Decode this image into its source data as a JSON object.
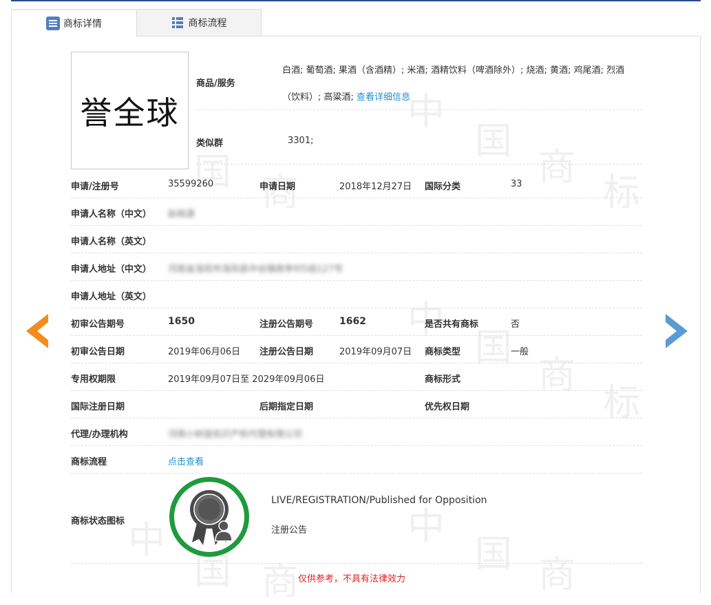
{
  "tabs": [
    {
      "label": "商标详情",
      "icon": "detail-list-icon"
    },
    {
      "label": "商标流程",
      "icon": "flow-list-icon"
    }
  ],
  "watermark_chars": [
    "中",
    "国",
    "商",
    "标"
  ],
  "logo": {
    "text": "誉全球"
  },
  "goods": {
    "label": "商品/服务",
    "line1": "白酒; 葡萄酒; 果酒（含酒精）; 米酒; 酒精饮料（啤酒除外）; 烧酒; 黄酒; 鸡尾酒; 烈酒",
    "line2": "（饮料）; 高粱酒;",
    "more_link": "查看详细信息"
  },
  "similar_group": {
    "label": "类似群",
    "value": "3301;"
  },
  "fields": {
    "reg_no": {
      "label": "申请/注册号",
      "value": "35599260"
    },
    "apply_date": {
      "label": "申请日期",
      "value": "2018年12月27日"
    },
    "intl_class": {
      "label": "国际分类",
      "value": "33"
    },
    "applicant_cn": {
      "label": "申请人名称（中文）",
      "value": "赵桃源"
    },
    "applicant_en": {
      "label": "申请人名称（英文）",
      "value": ""
    },
    "address_cn": {
      "label": "申请人地址（中文）",
      "value": "河南省洛阳市洛阳县中谷镇南李村5组127号"
    },
    "address_en": {
      "label": "申请人地址（英文）",
      "value": ""
    },
    "prelim_issue": {
      "label": "初审公告期号",
      "value": "1650"
    },
    "reg_issue": {
      "label": "注册公告期号",
      "value": "1662"
    },
    "shared": {
      "label": "是否共有商标",
      "value": "否"
    },
    "prelim_date": {
      "label": "初审公告日期",
      "value": "2019年06月06日"
    },
    "reg_date": {
      "label": "注册公告日期",
      "value": "2019年09月07日"
    },
    "tm_type": {
      "label": "商标类型",
      "value": "一般"
    },
    "exclusive_period": {
      "label": "专用权期限",
      "value": "2019年09月07日至 2029年09月06日"
    },
    "tm_form": {
      "label": "商标形式",
      "value": ""
    },
    "intl_reg_date": {
      "label": "国际注册日期",
      "value": ""
    },
    "later_desig_date": {
      "label": "后期指定日期",
      "value": ""
    },
    "priority_date": {
      "label": "优先权日期",
      "value": ""
    },
    "agency": {
      "label": "代理/办理机构",
      "value": "河南小树苗知识产权代理有限公司"
    },
    "flow": {
      "label": "商标流程",
      "link": "点击查看"
    }
  },
  "status": {
    "label": "商标状态图标",
    "en": "LIVE/REGISTRATION/Published for Opposition",
    "cn": "注册公告",
    "ring_color": "#1f9a3d"
  },
  "nav": {
    "prev_color": "#f28c1c",
    "next_color": "#5b9bd5"
  },
  "disclaimer": "仅供参考，不具有法律效力"
}
